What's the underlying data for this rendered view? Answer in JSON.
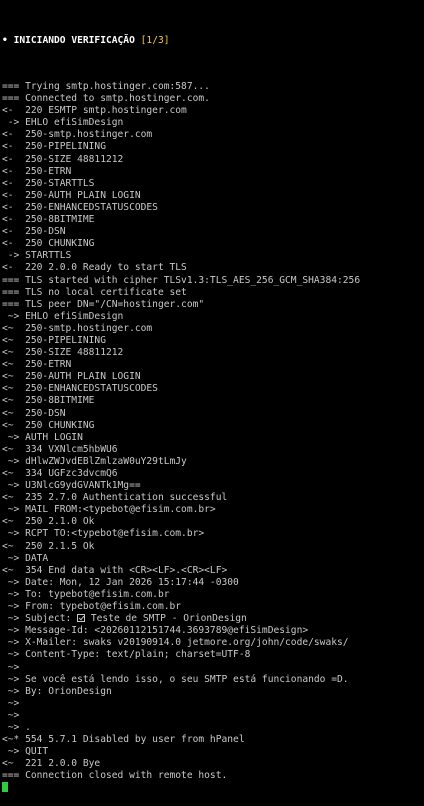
{
  "header": {
    "bullet": "•",
    "title": "INICIANDO VERIFICAÇÃO",
    "step": "[1/3]"
  },
  "lines": [
    "=== Trying smtp.hostinger.com:587...",
    "=== Connected to smtp.hostinger.com.",
    "<-  220 ESMTP smtp.hostinger.com",
    " -> EHLO efiSimDesign",
    "<-  250-smtp.hostinger.com",
    "<-  250-PIPELINING",
    "<-  250-SIZE 48811212",
    "<-  250-ETRN",
    "<-  250-STARTTLS",
    "<-  250-AUTH PLAIN LOGIN",
    "<-  250-ENHANCEDSTATUSCODES",
    "<-  250-8BITMIME",
    "<-  250-DSN",
    "<-  250 CHUNKING",
    " -> STARTTLS",
    "<-  220 2.0.0 Ready to start TLS",
    "=== TLS started with cipher TLSv1.3:TLS_AES_256_GCM_SHA384:256",
    "=== TLS no local certificate set",
    "=== TLS peer DN=\"/CN=hostinger.com\"",
    " ~> EHLO efiSimDesign",
    "<~  250-smtp.hostinger.com",
    "<~  250-PIPELINING",
    "<~  250-SIZE 48811212",
    "<~  250-ETRN",
    "<~  250-AUTH PLAIN LOGIN",
    "<~  250-ENHANCEDSTATUSCODES",
    "<~  250-8BITMIME",
    "<~  250-DSN",
    "<~  250 CHUNKING",
    " ~> AUTH LOGIN",
    "<~  334 VXNlcm5hbWU6",
    " ~> dHlwZWJvdEBlZmlzaW0uY29tLmJy",
    "<~  334 UGFzc3dvcmQ6",
    " ~> U3NlcG9ydGVANTk1Mg==",
    "<~  235 2.7.0 Authentication successful",
    " ~> MAIL FROM:<typebot@efisim.com.br>",
    "<~  250 2.1.0 Ok",
    " ~> RCPT TO:<typebot@efisim.com.br>",
    "<~  250 2.1.5 Ok",
    " ~> DATA",
    "<~  354 End data with <CR><LF>.<CR><LF>",
    " ~> Date: Mon, 12 Jan 2026 15:17:44 -0300",
    " ~> To: typebot@efisim.com.br",
    " ~> From: typebot@efisim.com.br",
    " ~> Subject: ",
    " ~> Message-Id: <20260112151744.3693789@efiSimDesign>",
    " ~> X-Mailer: swaks v20190914.0 jetmore.org/john/code/swaks/",
    " ~> Content-Type: text/plain; charset=UTF-8",
    " ~>",
    " ~> Se você está lendo isso, o seu SMTP está funcionando =D.",
    " ~> By: OrionDesign",
    " ~>",
    " ~>",
    " ~> .",
    "<~* 554 5.7.1 Disabled by user from hPanel",
    " ~> QUIT",
    "<~  221 2.0.0 Bye",
    "=== Connection closed with remote host."
  ],
  "subject_text": " Teste de SMTP - OrionDesign",
  "colors": {
    "background": "#000000",
    "text": "#c8c8c8",
    "header": "#ffffff",
    "step": "#f2c94c",
    "cursor": "#2ecc40"
  }
}
